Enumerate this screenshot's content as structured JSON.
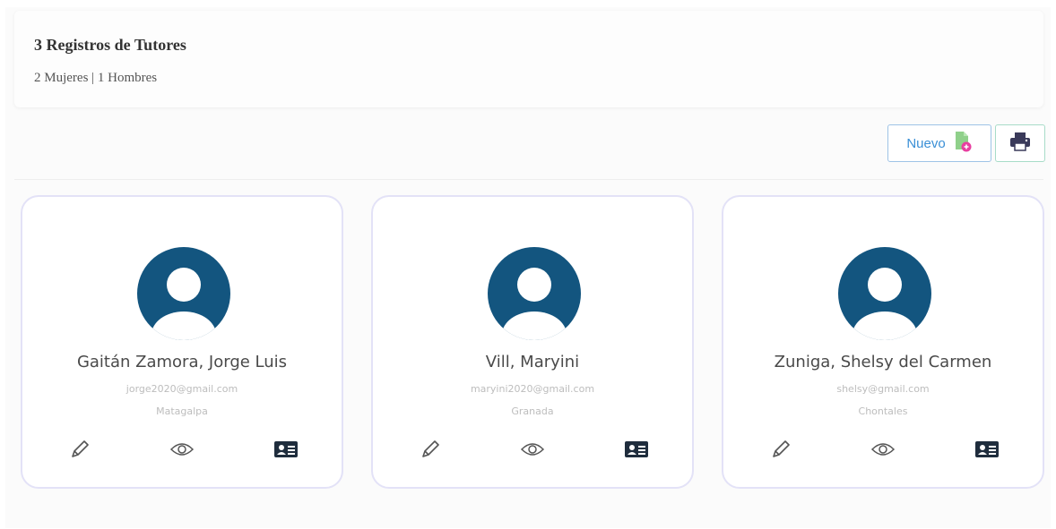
{
  "summary": {
    "title": "3 Registros de Tutores",
    "subtitle": "2 Mujeres | 1 Hombres"
  },
  "toolbar": {
    "new_label": "Nuevo",
    "new_icon": "add-document-icon",
    "print_icon": "printer-icon"
  },
  "colors": {
    "avatar": "#13557f",
    "new_button_text": "#3a8fd6",
    "card_border": "#e3e2f7"
  },
  "tutors": [
    {
      "name": "Gaitán Zamora, Jorge Luis",
      "email": "jorge2020@gmail.com",
      "city": "Matagalpa"
    },
    {
      "name": "Vill, Maryini",
      "email": "maryini2020@gmail.com",
      "city": "Granada"
    },
    {
      "name": "Zuniga, Shelsy del Carmen",
      "email": "shelsy@gmail.com",
      "city": "Chontales"
    }
  ],
  "card_actions": [
    "pencil-icon",
    "eye-icon",
    "id-card-icon"
  ]
}
